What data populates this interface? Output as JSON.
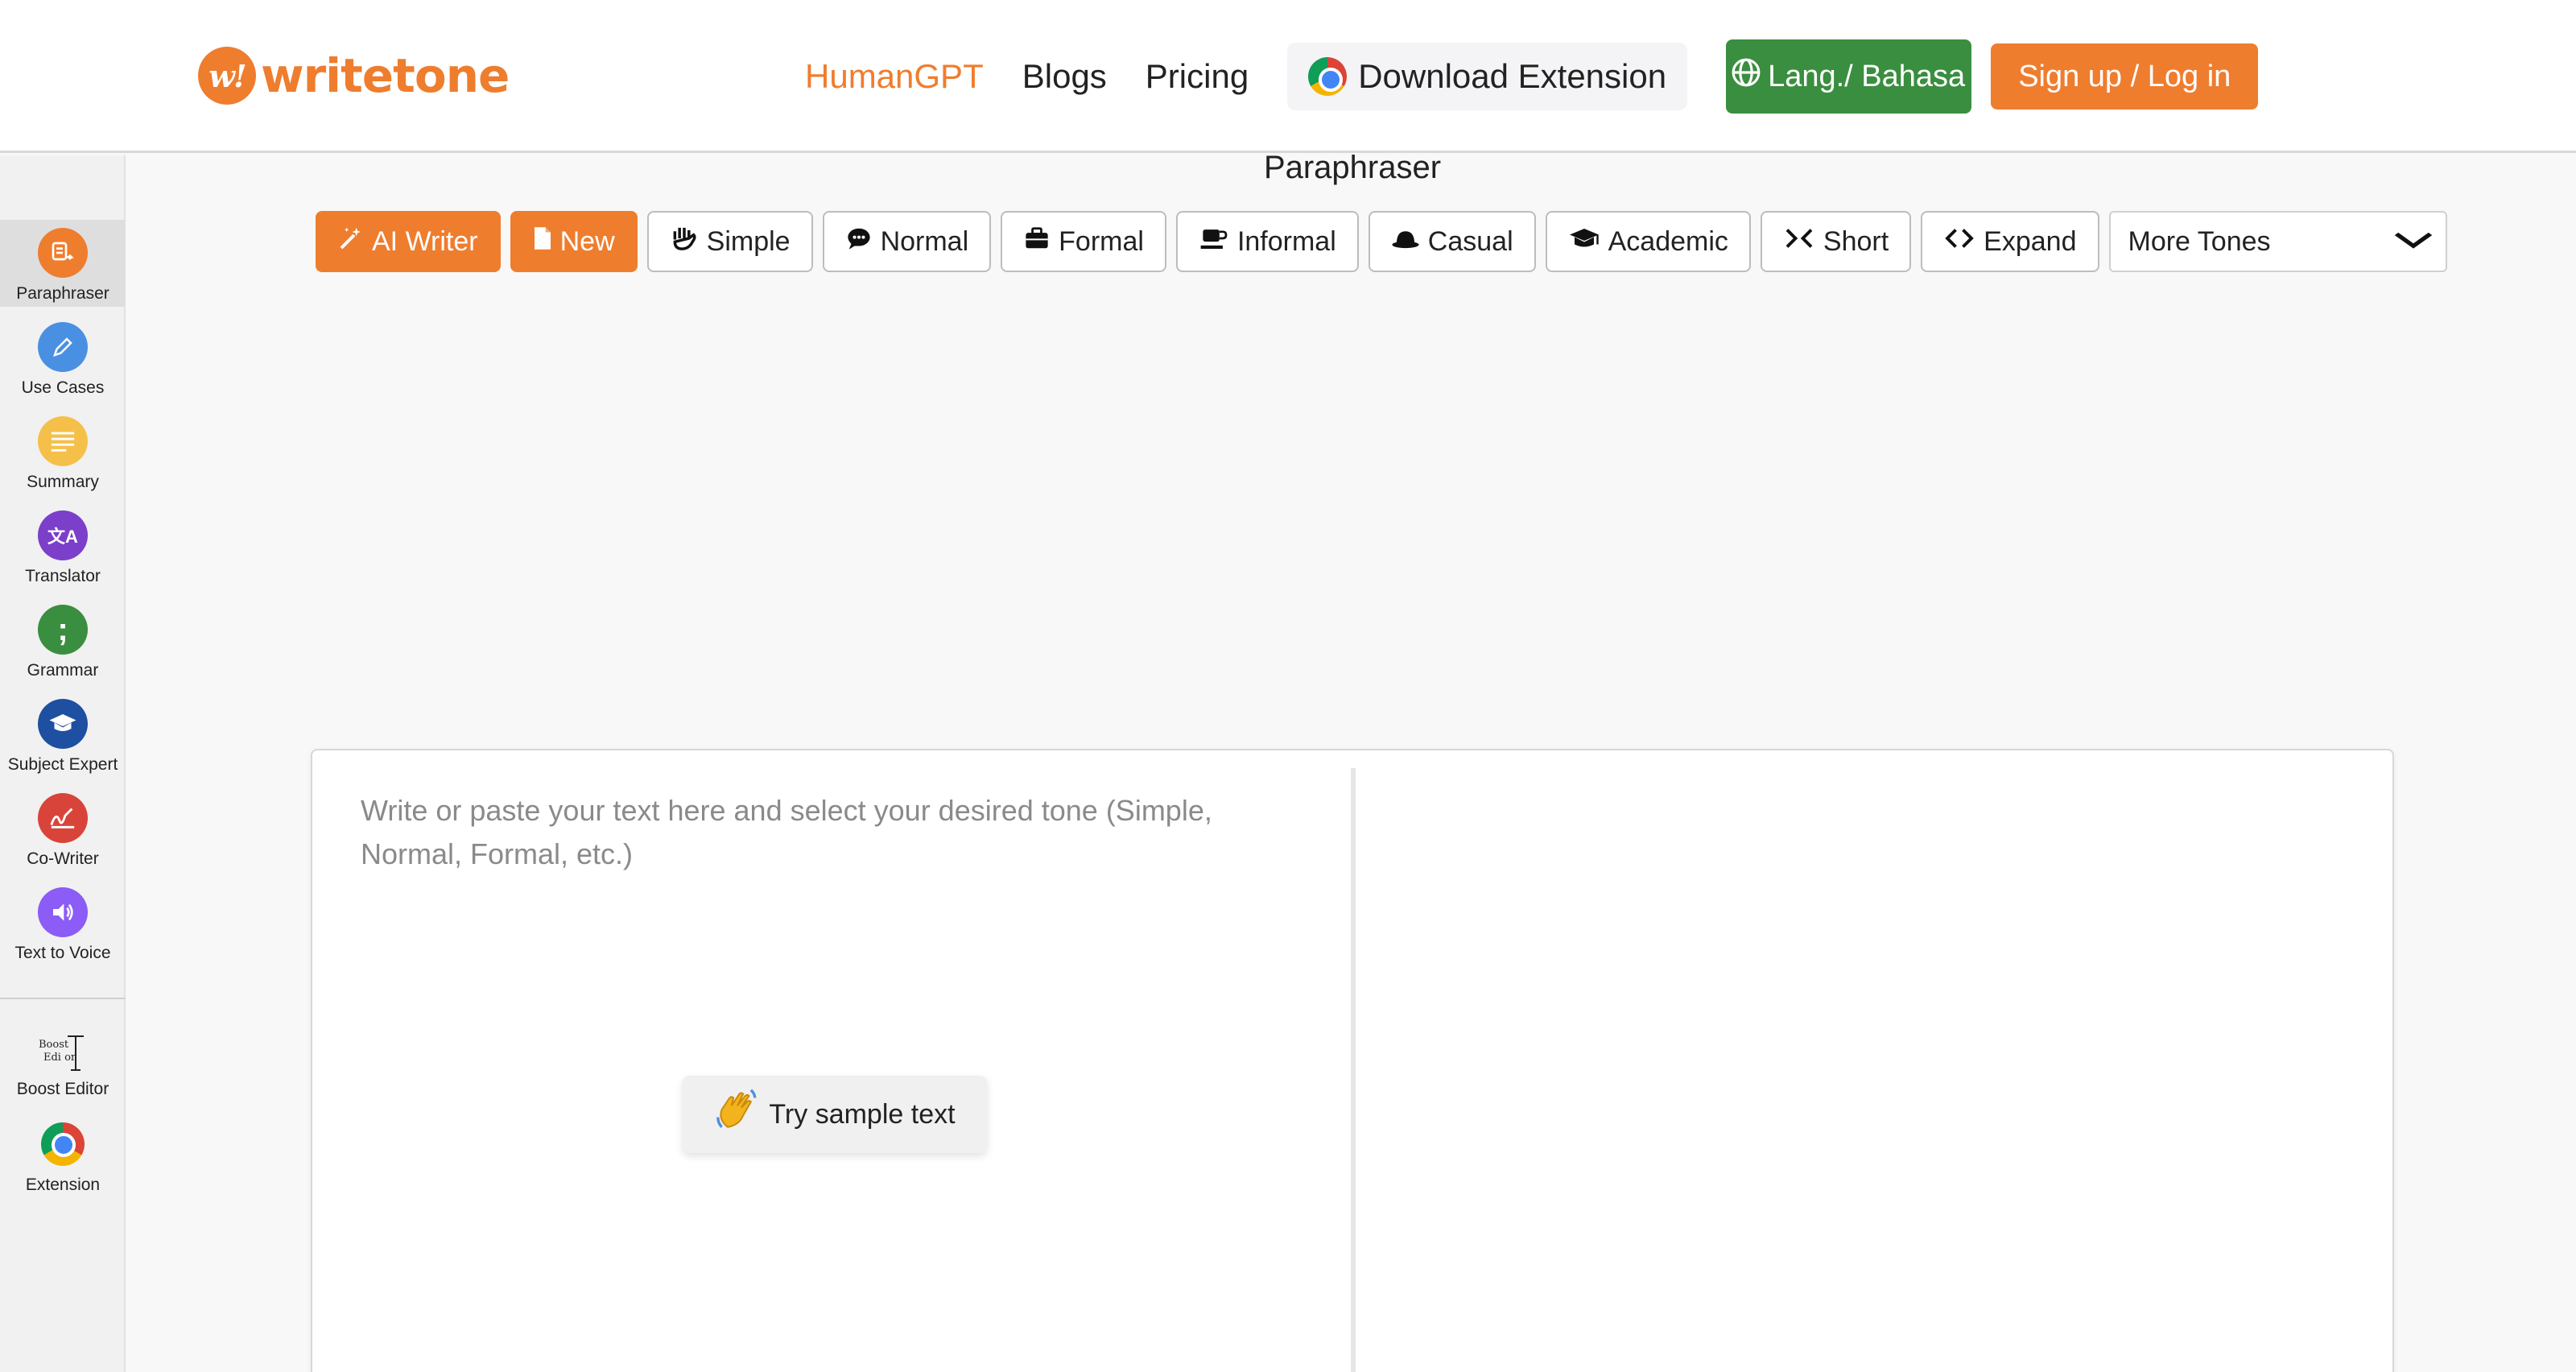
{
  "brand": {
    "mark": "w!",
    "name": "writetone",
    "color": "#ef7d2e"
  },
  "nav": {
    "links": [
      "HumanGPT",
      "Blogs",
      "Pricing"
    ],
    "download_extension": "Download Extension",
    "lang": "Lang./ Bahasa",
    "login": "Sign up / Log in"
  },
  "sidebar": {
    "items": [
      {
        "label": "Paraphraser",
        "icon": "paraphraser-icon",
        "color": "#ef7d2e"
      },
      {
        "label": "Use Cases",
        "icon": "pencil-icon",
        "color": "#4a90e2"
      },
      {
        "label": "Summary",
        "icon": "lines-icon",
        "color": "#f5c04a"
      },
      {
        "label": "Translator",
        "icon": "translate-icon",
        "color": "#7b3fc9"
      },
      {
        "label": "Grammar",
        "icon": "semicolon-icon",
        "color": "#3a8e3f"
      },
      {
        "label": "Subject Expert",
        "icon": "graduation-cap-icon",
        "color": "#1e4fa1"
      },
      {
        "label": "Co-Writer",
        "icon": "signature-icon",
        "color": "#d9443a"
      },
      {
        "label": "Text to Voice",
        "icon": "speaker-icon",
        "color": "#8b5cf6"
      }
    ],
    "extra": [
      {
        "label": "Boost Editor",
        "icon": "boost-editor-icon"
      },
      {
        "label": "Extension",
        "icon": "chrome-icon"
      }
    ]
  },
  "main": {
    "title": "Paraphraser",
    "tones": [
      {
        "label": "AI Writer",
        "icon": "magic-wand-icon",
        "style": "orange"
      },
      {
        "label": "New",
        "icon": "file-icon",
        "style": "orange"
      },
      {
        "label": "Simple",
        "icon": "hand-icon",
        "style": "plain"
      },
      {
        "label": "Normal",
        "icon": "speech-bubble-icon",
        "style": "plain"
      },
      {
        "label": "Formal",
        "icon": "briefcase-icon",
        "style": "plain"
      },
      {
        "label": "Informal",
        "icon": "coffee-cup-icon",
        "style": "plain"
      },
      {
        "label": "Casual",
        "icon": "hat-icon",
        "style": "plain"
      },
      {
        "label": "Academic",
        "icon": "graduation-cap-icon",
        "style": "plain"
      },
      {
        "label": "Short",
        "icon": "compress-icon",
        "style": "plain"
      },
      {
        "label": "Expand",
        "icon": "expand-icon",
        "style": "plain"
      }
    ],
    "more_tones": "More Tones",
    "editor": {
      "placeholder": "Write or paste your text here and select your desired tone (Simple, Normal, Formal, etc.)",
      "sample_button": "Try sample text"
    }
  }
}
